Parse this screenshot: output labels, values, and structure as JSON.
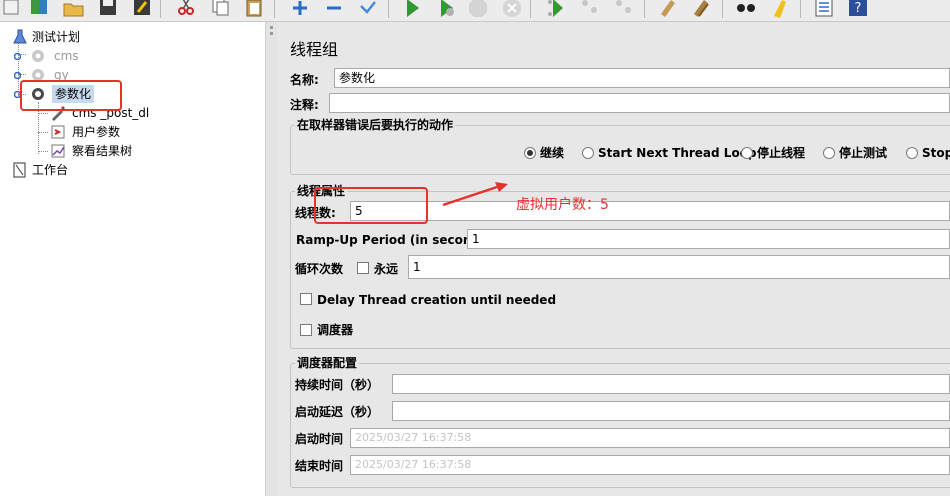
{
  "toolbar": {
    "buttons": [
      "new-icon",
      "templates-icon",
      "open-icon",
      "save-icon",
      "save-as-icon",
      "cut-icon",
      "copy-icon",
      "paste-icon",
      "expand-icon",
      "collapse-icon",
      "toggle-icon",
      "start-icon",
      "start-no-timers-icon",
      "stop-icon",
      "shutdown-icon",
      "remote-start-icon",
      "remote-stop-icon",
      "remote-shutdown-icon",
      "clear-icon",
      "clear-all-icon",
      "search-icon",
      "reset-search-icon",
      "function-helper-icon",
      "help-icon"
    ]
  },
  "tree": {
    "root": "测试计划",
    "group_cms": "cms",
    "group_gy": "gy",
    "selected_group": "参数化",
    "sampler": "cms _post_dl",
    "user_params": "用户参数",
    "result_tree": "察看结果树",
    "workbench": "工作台"
  },
  "form": {
    "heading": "线程组",
    "name_label": "名称:",
    "name_value": "参数化",
    "comment_label": "注释:",
    "comment_value": "",
    "error_action": {
      "title": "在取样器错误后要执行的动作",
      "options": [
        "继续",
        "Start Next Thread Loop",
        "停止线程",
        "停止测试",
        "Stop"
      ],
      "selected_index": 0
    },
    "thread_props": {
      "title": "线程属性",
      "threads_label": "线程数:",
      "threads_value": "5",
      "rampup_label": "Ramp-Up Period (in seconds):",
      "rampup_value": "1",
      "loop_label": "循环次数",
      "forever_label": "永远",
      "forever_checked": false,
      "loop_value": "1",
      "delay_label": "Delay Thread creation until needed",
      "delay_checked": false,
      "scheduler_label": "调度器",
      "scheduler_checked": false
    },
    "scheduler_config": {
      "title": "调度器配置",
      "duration_label": "持续时间（秒）",
      "duration_value": "",
      "delay_label": "启动延迟（秒）",
      "delay_value": "",
      "start_label": "启动时间",
      "start_value": "2025/03/27 16:37:58",
      "end_label": "结束时间",
      "end_value": "2025/03/27 16:37:58"
    }
  },
  "annotation": {
    "text": "虚拟用户数：5",
    "color": "#e5322d"
  }
}
